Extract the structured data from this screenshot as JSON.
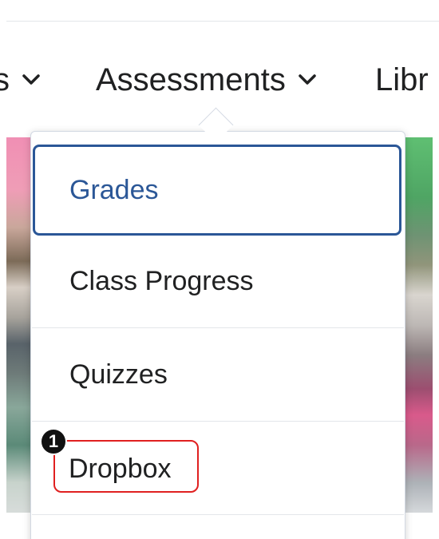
{
  "nav": {
    "prev_label": "s",
    "assessments_label": "Assessments",
    "next_label": "Libr",
    "chevron_icon": "chevron-down-icon"
  },
  "menu": {
    "items": [
      {
        "label": "Grades",
        "state": "focused"
      },
      {
        "label": "Class Progress"
      },
      {
        "label": "Quizzes"
      },
      {
        "label": "Dropbox",
        "state": "highlighted"
      }
    ]
  },
  "annotation": {
    "badge_number": "1",
    "highlight_color": "#e02020"
  },
  "colors": {
    "focus": "#2b5797",
    "text": "#202122"
  }
}
